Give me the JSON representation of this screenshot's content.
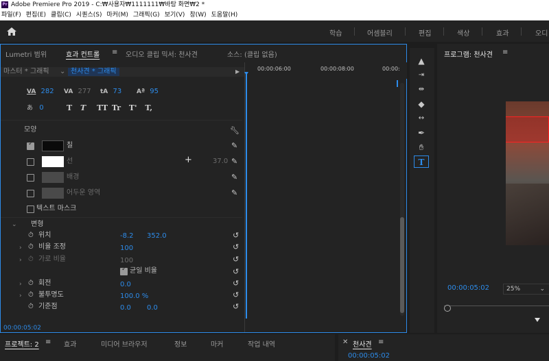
{
  "app": {
    "title": "Adobe Premiere Pro 2019 - C:₩사용자₩1111111₩바탕 화면₩2 *",
    "icon_label": "Pr"
  },
  "menu": [
    "파일(F)",
    "편집(E)",
    "클립(C)",
    "시퀀스(S)",
    "마커(M)",
    "그래픽(G)",
    "보기(V)",
    "창(W)",
    "도움말(H)"
  ],
  "workspaces": [
    "학습",
    "어셈블리",
    "편집",
    "색상",
    "효과",
    "오디"
  ],
  "left_tabs": {
    "lumetri": "Lumetri 범위",
    "effect_controls": "효과 컨트롤",
    "effect_controls_menu": "≡",
    "audio_mixer": "오디오 클립 믹서: 천사견",
    "source": "소스: (클립 없음)"
  },
  "seq": {
    "master": "마스터 * 그래픽",
    "chev": "⌄",
    "clip": "천사견 * 그래픽",
    "play": "▶"
  },
  "text_props": {
    "kerning": "282",
    "tracking": "277",
    "leading": "73",
    "baseline": "95",
    "tsume": "0",
    "style_buttons": [
      "T",
      "T",
      "TT",
      "Tr",
      "T'",
      "T,"
    ]
  },
  "appearance": {
    "section": "모양",
    "fill": "칠",
    "stroke": "선",
    "stroke_width": "37.0",
    "background": "배경",
    "shadow": "어두운 영역",
    "mask": "텍스트 마스크"
  },
  "transform": {
    "section": "변형",
    "position_label": "위치",
    "position_x": "-8.2",
    "position_y": "352.0",
    "scale_label": "비율 조정",
    "scale": "100",
    "scale_width_label": "가로 비율",
    "scale_width": "100",
    "uniform_label": "균일 비율",
    "rotation_label": "회전",
    "rotation": "0.0",
    "opacity_label": "불투명도",
    "opacity": "100.0 %",
    "anchor_label": "기준점",
    "anchor_x": "0.0",
    "anchor_y": "0.0"
  },
  "ruler": [
    "00:00:06:00",
    "00:00:08:00",
    "00:00:"
  ],
  "bottom_timecode": "00:00:05:02",
  "program": {
    "title": "프로그램: 천사견",
    "menu": "≡",
    "timecode": "00:00:05:02",
    "zoom": "25%",
    "zoom_chev": "⌄"
  },
  "bottom_tabs": [
    "프로젝트: 2",
    "효과",
    "미디어 브라우저",
    "정보",
    "마커",
    "작업 내역"
  ],
  "bottom_menu": "≡",
  "timeline_panel": {
    "close": "✕",
    "title": "천사견",
    "menu": "≡",
    "timecode": "00:00:05:02"
  },
  "colors": {
    "accent": "#2d8ceb",
    "panel": "#232323",
    "fill_swatch": "#0a0a0a",
    "stroke_swatch": "#ffffff"
  }
}
